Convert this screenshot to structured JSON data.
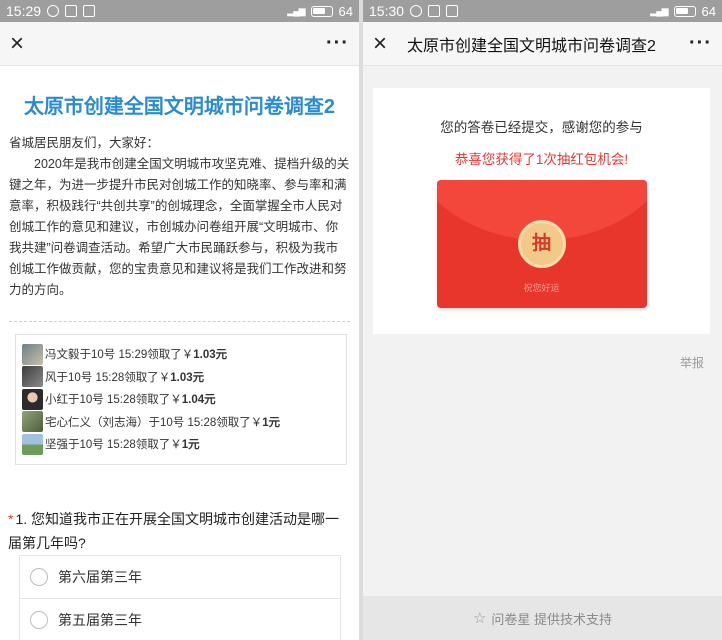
{
  "left": {
    "status": {
      "time": "15:29",
      "battery": "64"
    },
    "nav": {
      "close": "×",
      "more": "···"
    },
    "title": "太原市创建全国文明城市问卷调查2",
    "greeting": "省城居民朋友们，大家好：",
    "paragraph": "2020年是我市创建全国文明城市攻坚克难、提档升级的关键之年，为进一步提升市民对创城工作的知晓率、参与率和满意率，积极践行“共创共享”的创城理念，全面掌握全市人民对创城工作的意见和建议，市创城办问卷组开展“文明城市、你我共建”问卷调查活动。希望广大市民踊跃参与，积极为我市创城工作做贡献，您的宝贵意见和建议将是我们工作改进和努力的方向。",
    "winners": [
      {
        "name": "冯文毅",
        "text": "于10号 15:29领取了￥",
        "amount": "1.03元"
      },
      {
        "name": "风",
        "text": "于10号 15:28领取了￥",
        "amount": "1.03元"
      },
      {
        "name": "小红",
        "text": "于10号 15:28领取了￥",
        "amount": "1.04元"
      },
      {
        "name": "宅心仁义（刘志海）",
        "text": "于10号 15:28领取了￥",
        "amount": "1元"
      },
      {
        "name": "坚强",
        "text": "于10号 15:28领取了￥",
        "amount": "1元"
      }
    ],
    "question": {
      "required": "*",
      "text": "1. 您知道我市正在开展全国文明城市创建活动是哪一届第几年吗?"
    },
    "options": [
      "第六届第三年",
      "第五届第三年"
    ]
  },
  "right": {
    "status": {
      "time": "15:30",
      "battery": "64"
    },
    "nav": {
      "close": "×",
      "title": "太原市创建全国文明城市问卷调查2",
      "more": "···"
    },
    "submitted": "您的答卷已经提交，感谢您的参与",
    "lucky": "恭喜您获得了1次抽红包机会!",
    "draw_label": "抽",
    "wish": "祝您好运",
    "report": "举报",
    "footer": "问卷星 提供技术支持"
  },
  "colors": {
    "title_blue": "#2a8ccf",
    "red": "#e53935",
    "envelope": "#e8362d"
  }
}
